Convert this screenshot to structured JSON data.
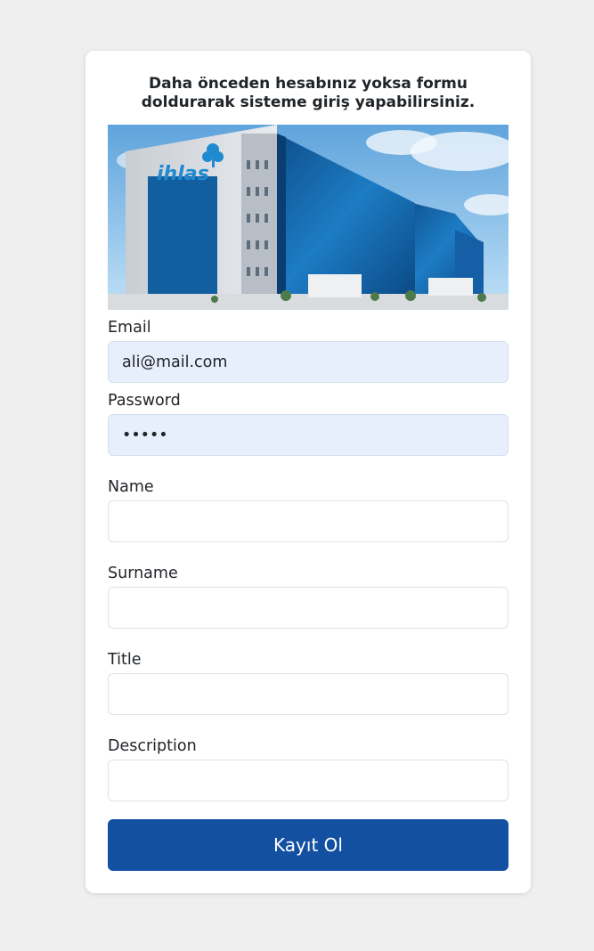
{
  "intro": "Daha önceden hesabınız yoksa formu doldurarak sisteme giriş yapabilirsiniz.",
  "hero": {
    "logo_text": "ihlas",
    "icon": "tree-logo-icon",
    "colors": {
      "sky": "#8fc3ec",
      "glass": "#1a73b8",
      "logo": "#1f8ad0"
    }
  },
  "fields": {
    "email": {
      "label": "Email",
      "value": "ali@mail.com"
    },
    "password": {
      "label": "Password",
      "value": "•••••"
    },
    "name": {
      "label": "Name",
      "value": ""
    },
    "surname": {
      "label": "Surname",
      "value": ""
    },
    "title": {
      "label": "Title",
      "value": ""
    },
    "description": {
      "label": "Description",
      "value": ""
    }
  },
  "submit_label": "Kayıt Ol",
  "colors": {
    "page_bg": "#efefef",
    "primary": "#1350a2",
    "autofill_bg": "#e8effc"
  }
}
